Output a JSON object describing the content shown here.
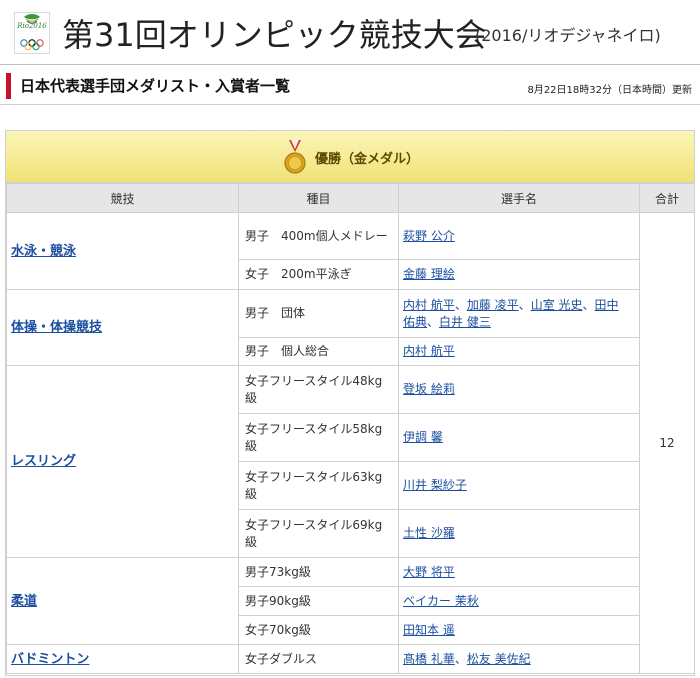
{
  "header": {
    "logo_text": "Rio2016",
    "title": "第31回オリンピック競技大会",
    "subtitle": "(2016/リオデジャネイロ)"
  },
  "section": {
    "title": "日本代表選手団メダリスト・入賞者一覧",
    "updated": "8月22日18時32分（日本時間）更新"
  },
  "medal_table": {
    "heading": "優勝（金メダル）",
    "columns": [
      "競技",
      "種目",
      "選手名",
      "合計"
    ],
    "total": "12",
    "rows": [
      {
        "sport": "水泳・競泳",
        "event": "男子　400m個人メドレー",
        "names": [
          "萩野 公介"
        ]
      },
      {
        "sport": "",
        "event": "女子　200m平泳ぎ",
        "names": [
          "金藤 理絵"
        ]
      },
      {
        "sport": "体操・体操競技",
        "event": "男子　団体",
        "names": [
          "内村 航平",
          "加藤 凌平",
          "山室 光史",
          "田中 佑典",
          "白井 健三"
        ]
      },
      {
        "sport": "",
        "event": "男子　個人総合",
        "names": [
          "内村 航平"
        ]
      },
      {
        "sport": "レスリング",
        "event": "女子フリースタイル48kg級",
        "names": [
          "登坂 絵莉"
        ]
      },
      {
        "sport": "",
        "event": "女子フリースタイル58kg級",
        "names": [
          "伊調 馨"
        ]
      },
      {
        "sport": "",
        "event": "女子フリースタイル63kg級",
        "names": [
          "川井 梨紗子"
        ]
      },
      {
        "sport": "",
        "event": "女子フリースタイル69kg級",
        "names": [
          "土性 沙羅"
        ]
      },
      {
        "sport": "柔道",
        "event": "男子73kg級",
        "names": [
          "大野 将平"
        ]
      },
      {
        "sport": "",
        "event": "男子90kg級",
        "names": [
          "ベイカー 茉秋"
        ]
      },
      {
        "sport": "",
        "event": "女子70kg級",
        "names": [
          "田知本 遥"
        ]
      },
      {
        "sport": "バドミントン",
        "event": "女子ダブルス",
        "names": [
          "髙橋 礼華",
          "松友 美佐紀"
        ]
      }
    ]
  },
  "colors": {
    "accent_red": "#c8102e",
    "link_blue": "#1c4fa0",
    "gold_header": "#f1e276"
  }
}
